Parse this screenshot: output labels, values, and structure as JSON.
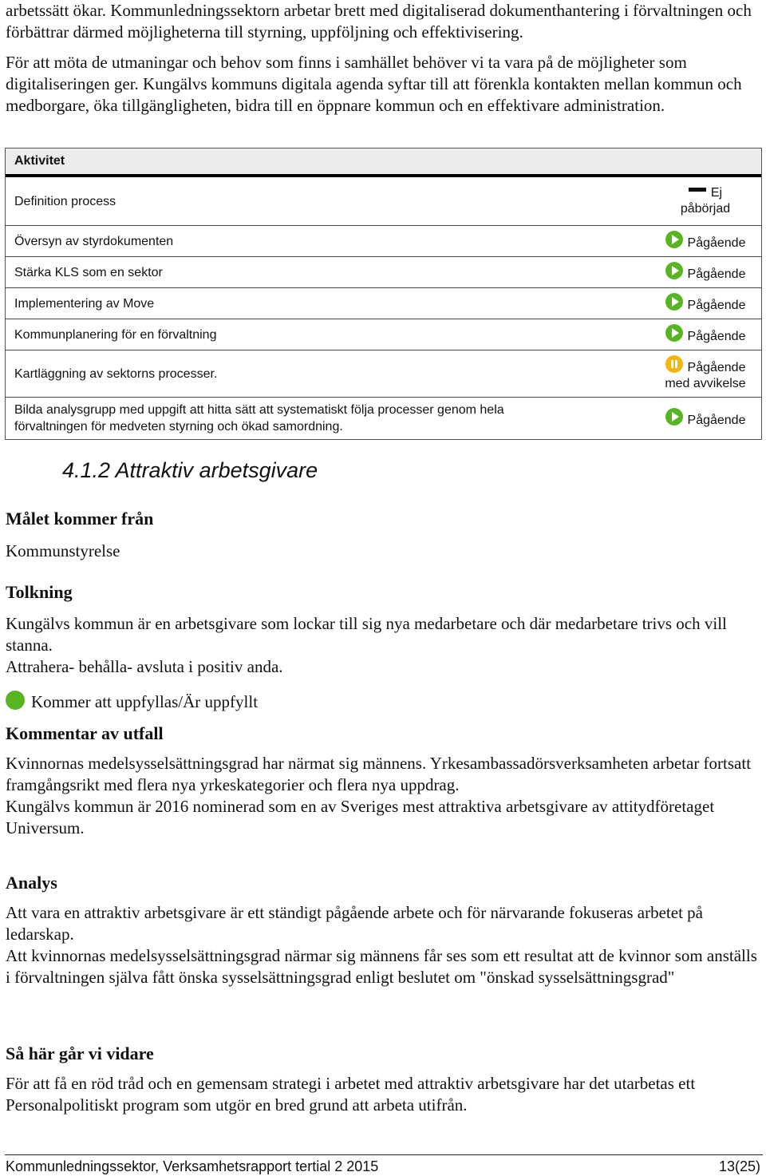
{
  "intro": {
    "paragraph1": "arbetssätt ökar. Kommunledningssektorn arbetar brett med digitaliserad dokumenthantering i förvaltningen och förbättrar därmed möjligheterna till styrning, uppföljning och effektivisering.",
    "paragraph2": "För att möta de utmaningar och behov som finns i samhället behöver vi ta vara på de möjligheter som digitaliseringen ger. Kungälvs kommuns digitala agenda syftar till att förenkla kontakten mellan kommun och medborgare, öka tillgängligheten, bidra till en öppnare kommun och en effektivare administration."
  },
  "activity_table": {
    "header": "Aktivitet",
    "rows": [
      {
        "activity": "Definition process",
        "status_icon": "dash-icon",
        "status": "Ej påbörjad"
      },
      {
        "activity": "Översyn av styrdokumenten",
        "status_icon": "play-icon",
        "status": "Pågående"
      },
      {
        "activity": "Stärka KLS som en sektor",
        "status_icon": "play-icon",
        "status": "Pågående"
      },
      {
        "activity": "Implementering av Move",
        "status_icon": "play-icon",
        "status": "Pågående"
      },
      {
        "activity": "Kommunplanering för en förvaltning",
        "status_icon": "play-icon",
        "status": "Pågående"
      },
      {
        "activity": "Kartläggning av sektorns processer.",
        "status_icon": "pause-icon",
        "status": "Pågående med avvikelse"
      },
      {
        "activity": "Bilda analysgrupp med uppgift att hitta sätt att systematiskt följa processer genom hela förvaltningen för medveten styrning och ökad samordning.",
        "status_icon": "play-icon",
        "status": "Pågående"
      }
    ],
    "colors": {
      "ongoing": "#57b521",
      "deviation": "#f5b50f",
      "header_bg": "#ececec"
    }
  },
  "section": {
    "heading": "4.1.2  Attraktiv arbetsgivare",
    "origin_label": "Målet kommer från",
    "origin_value": "Kommunstyrelse",
    "interpretation_label": "Tolkning",
    "interpretation_text1": "Kungälvs kommun är en arbetsgivare som lockar till sig nya medarbetare och där medarbetare trivs och vill stanna.",
    "interpretation_text2": "Attrahera- behålla- avsluta i positiv anda.",
    "goal_status": "Kommer att uppfyllas/Är uppfyllt",
    "comment_label": "Kommentar av utfall",
    "comment_text1": "Kvinnornas medelsysselsättningsgrad har närmat sig männens. Yrkesambassadörsverksamheten arbetar fortsatt framgångsrikt med flera nya yrkeskategorier och flera nya uppdrag.",
    "comment_text2": "Kungälvs kommun är 2016 nominerad som en av Sveriges mest attraktiva arbetsgivare av attitydföretaget Universum.",
    "analysis_label": "Analys",
    "analysis_text1": "Att vara en attraktiv arbetsgivare är ett ständigt pågående arbete och för närvarande fokuseras arbetet på ledarskap.",
    "analysis_text2": "Att kvinnornas medelsysselsättningsgrad närmar sig männens får ses som ett resultat att de kvinnor som anställs i förvaltningen själva fått önska sysselsättningsgrad enligt beslutet om \"önskad sysselsättningsgrad\"",
    "next_label": "Så här går vi vidare",
    "next_text": "För att få en röd tråd och en gemensam strategi i arbetet med attraktiv arbetsgivare har det utarbetas ett Personalpolitiskt program som utgör en bred grund att arbeta utifrån."
  },
  "footer": {
    "title": "Kommunledningssektor, Verksamhetsrapport tertial 2 2015",
    "page": "13(25)"
  }
}
